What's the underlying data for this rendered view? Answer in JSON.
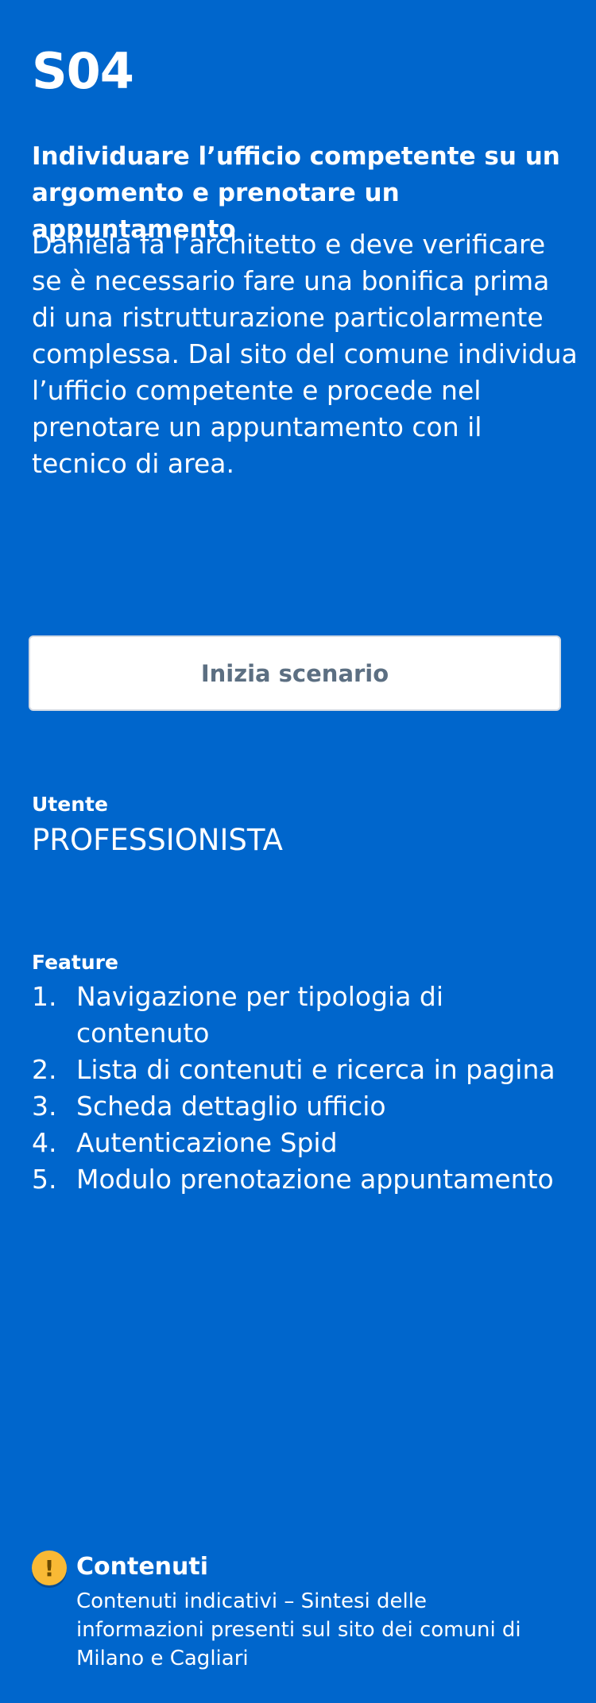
{
  "scenario": {
    "code": "S04",
    "title": "Individuare l’ufficio competente su un argomento e prenotare un appuntamento",
    "description": "Daniela fa l’architetto e deve verificare se è necessario fare una bonifica prima di una ristrutturazione particolarmente complessa. Dal sito del comune individua l’ufficio competente e procede nel prenotare un appuntamento con il tecnico di area."
  },
  "start_button": {
    "label": "Inizia scenario"
  },
  "user": {
    "label": "Utente",
    "value": "PROFESSIONISTA"
  },
  "features": {
    "label": "Feature",
    "items": [
      {
        "num": "1.",
        "text": "Navigazione per tipologia di contenuto"
      },
      {
        "num": "2.",
        "text": "Lista di contenuti e ricerca in pagina"
      },
      {
        "num": "3.",
        "text": "Scheda dettaglio ufficio"
      },
      {
        "num": "4.",
        "text": "Autenticazione Spid"
      },
      {
        "num": "5.",
        "text": "Modulo prenotazione appuntamento"
      }
    ]
  },
  "contents": {
    "icon": "warning-icon",
    "icon_glyph": "!",
    "title": "Contenuti",
    "text": "Contenuti indicativi – Sintesi delle informazioni presenti sul sito dei comuni di Milano e Cagliari"
  },
  "colors": {
    "background": "#0066cc",
    "button_bg": "#ffffff",
    "button_text": "#5c6f82",
    "warning": "#f9b935"
  }
}
